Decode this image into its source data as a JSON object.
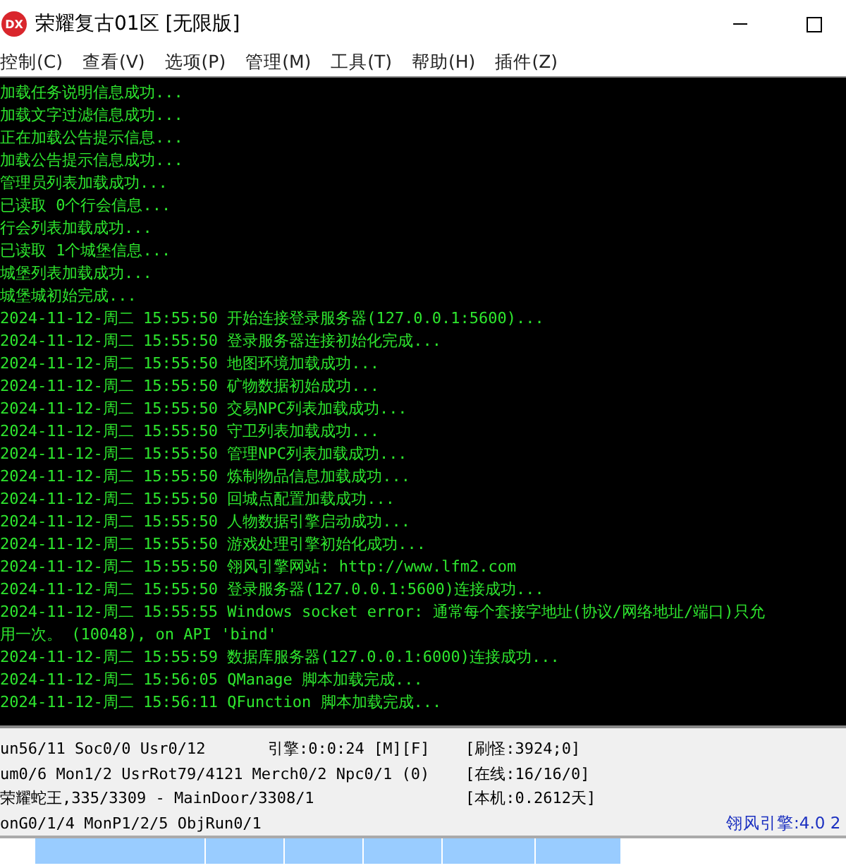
{
  "window": {
    "icon_text": "DX",
    "title": "荣耀复古01区 [无限版]"
  },
  "menu": [
    "控制(C)",
    "查看(V)",
    "选项(P)",
    "管理(M)",
    "工具(T)",
    "帮助(H)",
    "插件(Z)"
  ],
  "console_lines": [
    "加载任务说明信息成功...",
    "加载文字过滤信息成功...",
    "正在加载公告提示信息...",
    "加载公告提示信息成功...",
    "管理员列表加载成功...",
    "已读取 0个行会信息...",
    "行会列表加载成功...",
    "已读取 1个城堡信息...",
    "城堡列表加载成功...",
    "城堡城初始完成...",
    "2024-11-12-周二 15:55:50 开始连接登录服务器(127.0.0.1:5600)...",
    "2024-11-12-周二 15:55:50 登录服务器连接初始化完成...",
    "2024-11-12-周二 15:55:50 地图环境加载成功...",
    "2024-11-12-周二 15:55:50 矿物数据初始成功...",
    "2024-11-12-周二 15:55:50 交易NPC列表加载成功...",
    "2024-11-12-周二 15:55:50 守卫列表加载成功...",
    "2024-11-12-周二 15:55:50 管理NPC列表加载成功...",
    "2024-11-12-周二 15:55:50 炼制物品信息加载成功...",
    "2024-11-12-周二 15:55:50 回城点配置加载成功...",
    "2024-11-12-周二 15:55:50 人物数据引擎启动成功...",
    "2024-11-12-周二 15:55:50 游戏处理引擎初始化成功...",
    "2024-11-12-周二 15:55:50 翎风引擎网站: http://www.lfm2.com",
    "2024-11-12-周二 15:55:50 登录服务器(127.0.0.1:5600)连接成功...",
    "2024-11-12-周二 15:55:55 Windows socket error: 通常每个套接字地址(协议/网络地址/端口)只允",
    "用一次。 (10048), on API 'bind'",
    "2024-11-12-周二 15:55:59 数据库服务器(127.0.0.1:6000)连接成功...",
    "2024-11-12-周二 15:56:05 QManage 脚本加载完成...",
    "2024-11-12-周二 15:56:11 QFunction 脚本加载完成..."
  ],
  "status_rows": [
    {
      "col_1": "un56/11 Soc0/0 Usr0/12",
      "col_2": "引擎:0:0:24 [M][F]",
      "col_3": "[刷怪:3924;0]"
    },
    {
      "col_1": "um0/6 Mon1/2 UsrRot79/4121 Merch0/2 Npc0/1 (0)",
      "col_3": "[在线:16/16/0]"
    },
    {
      "col_1": "荣耀蛇王,335/3309 - MainDoor/3308/1",
      "col_3": "[本机:0.2612天]"
    },
    {
      "col_1": "onG0/1/4 MonP1/2/5 ObjRun0/1",
      "col_4": "翎风引擎:4.0 2"
    }
  ]
}
